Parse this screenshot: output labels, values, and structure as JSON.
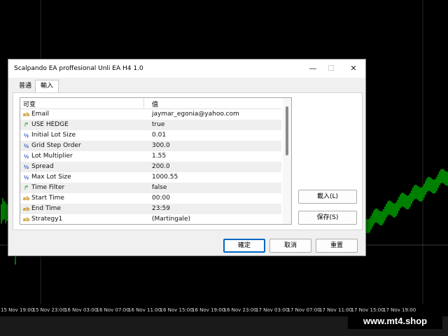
{
  "chart": {
    "time_labels": [
      "15 Nov 19:00",
      "15 Nov 23:00",
      "16 Nov 03:00",
      "16 Nov 07:00",
      "16 Nov 11:00",
      "16 Nov 15:00",
      "16 Nov 19:00",
      "16 Nov 23:00",
      "17 Nov 03:00",
      "17 Nov 07:00",
      "17 Nov 11:00",
      "17 Nov 15:00",
      "17 Nov 19:00"
    ],
    "candle_color": "#00ff00",
    "background": "#000000"
  },
  "watermark": "www.mt4.shop",
  "dialog": {
    "title": "Scalpando EA proffesional Unli EA H4 1.0",
    "controls": {
      "minimize": "—",
      "maximize": "☐",
      "close": "✕"
    },
    "tabs": [
      "普通",
      "輸入"
    ],
    "active_tab": 1,
    "grid": {
      "headers": {
        "variable": "可变",
        "value": "值"
      },
      "rows": [
        {
          "icon": "ab",
          "type": "text",
          "name": "Email",
          "value": "jaymar_egonia@yahoo.com"
        },
        {
          "icon": "bool-arrow-icon",
          "type": "bool",
          "name": "USE HEDGE",
          "value": "true"
        },
        {
          "icon": "½",
          "type": "num",
          "name": "Initial Lot Size",
          "value": "0.01"
        },
        {
          "icon": "½",
          "type": "num",
          "name": "Grid Step Order",
          "value": "300.0"
        },
        {
          "icon": "½",
          "type": "num",
          "name": "Lot Multiplier",
          "value": "1.55"
        },
        {
          "icon": "½",
          "type": "num",
          "name": "Spread",
          "value": "200.0"
        },
        {
          "icon": "½",
          "type": "num",
          "name": "Max Lot Size",
          "value": "1000.55"
        },
        {
          "icon": "bool-arrow-icon",
          "type": "bool",
          "name": "Time Filter",
          "value": "false"
        },
        {
          "icon": "ab",
          "type": "text",
          "name": "Start Time",
          "value": "00:00"
        },
        {
          "icon": "ab",
          "type": "text",
          "name": "End Time",
          "value": "23:59"
        },
        {
          "icon": "ab",
          "type": "text",
          "name": "Strategy1",
          "value": "(Martingale)"
        }
      ]
    },
    "buttons": {
      "load": "載入(L)",
      "save": "保存(S)",
      "ok": "確定",
      "cancel": "取消",
      "reset": "重置"
    }
  }
}
